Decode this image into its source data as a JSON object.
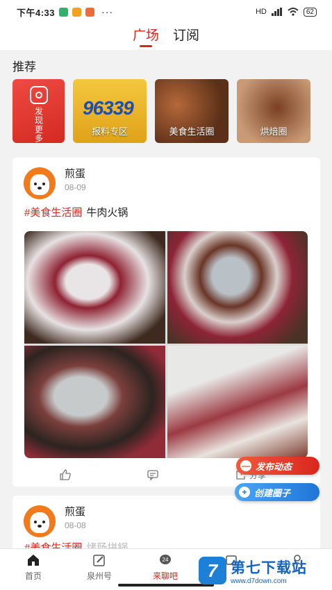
{
  "status_bar": {
    "time": "下午4:33",
    "battery": "62",
    "network": "HD",
    "more": "···"
  },
  "top_tabs": [
    {
      "label": "广场",
      "active": true
    },
    {
      "label": "订阅",
      "active": false
    }
  ],
  "recommend": {
    "title": "推荐",
    "discover_label": "发现更多",
    "cards": [
      {
        "label": "报料专区",
        "number": "96339"
      },
      {
        "label": "美食生活圈"
      },
      {
        "label": "烘焙圈"
      }
    ]
  },
  "posts": [
    {
      "user": "煎蛋",
      "date": "08-09",
      "tag": "#美食生活圈",
      "text": "牛肉火锅",
      "share_label": "分享"
    },
    {
      "user": "煎蛋",
      "date": "08-08",
      "tag": "#美食生活圈",
      "text": "烤肠拼锅"
    }
  ],
  "fabs": {
    "publish": "发布动态",
    "create": "创建圈子"
  },
  "bottom_nav": [
    {
      "label": "首页"
    },
    {
      "label": "泉州号"
    },
    {
      "label": "来聊吧",
      "active": true,
      "badge": "24"
    }
  ],
  "watermark": {
    "title": "第七下载站",
    "url": "www.d7down.com"
  },
  "colors": {
    "accent": "#d9271c",
    "blue": "#1f75d8"
  }
}
